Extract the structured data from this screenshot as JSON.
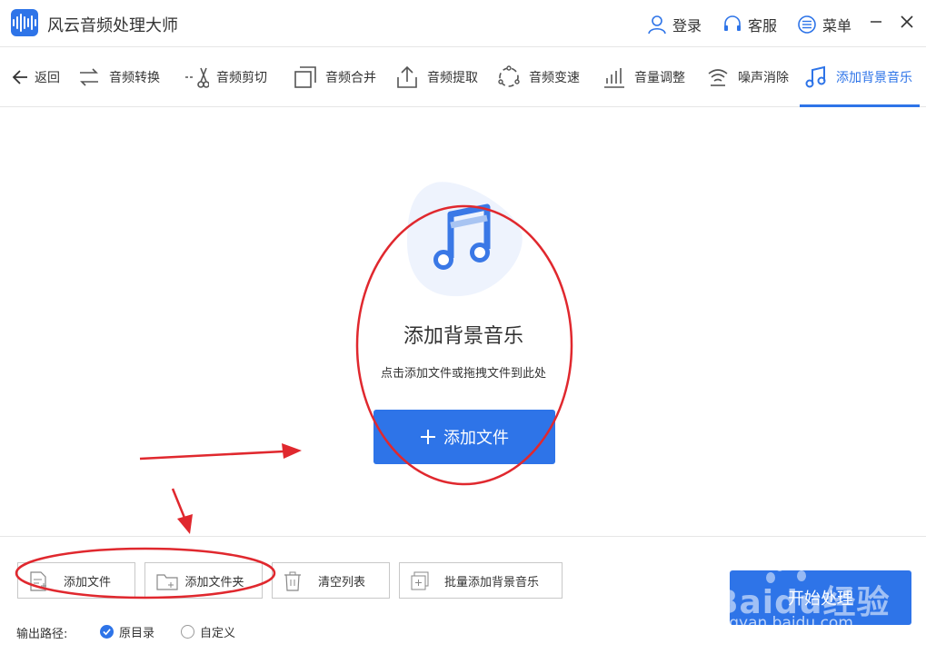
{
  "app": {
    "title": "风云音频处理大师"
  },
  "titlebar": {
    "login": "登录",
    "service": "客服",
    "menu": "菜单"
  },
  "toolbar": {
    "back": "返回",
    "tools": [
      {
        "label": "音频转换",
        "icon": "convert-icon"
      },
      {
        "label": "音频剪切",
        "icon": "scissors-icon"
      },
      {
        "label": "音频合并",
        "icon": "merge-icon"
      },
      {
        "label": "音频提取",
        "icon": "upload-icon"
      },
      {
        "label": "音频变速",
        "icon": "speed-icon"
      },
      {
        "label": "音量调整",
        "icon": "volume-bars-icon"
      },
      {
        "label": "噪声消除",
        "icon": "noise-icon"
      },
      {
        "label": "添加背景音乐",
        "icon": "music-note-icon",
        "active": true
      }
    ]
  },
  "drop": {
    "title": "添加背景音乐",
    "hint": "点击添加文件或拖拽文件到此处",
    "add_button": "添加文件"
  },
  "bottom": {
    "add_file": "添加文件",
    "add_folder": "添加文件夹",
    "clear_list": "清空列表",
    "batch_add_bgm": "批量添加背景音乐",
    "output_label": "输出路径:",
    "option_original": "原目录",
    "option_custom": "自定义",
    "selected_option": "原目录",
    "start": "开始处理"
  },
  "watermark": {
    "brand": "Baidu经验",
    "url": "jingyan.baidu.com"
  },
  "colors": {
    "accent": "#2e74e8",
    "annotation": "#e0282e"
  }
}
